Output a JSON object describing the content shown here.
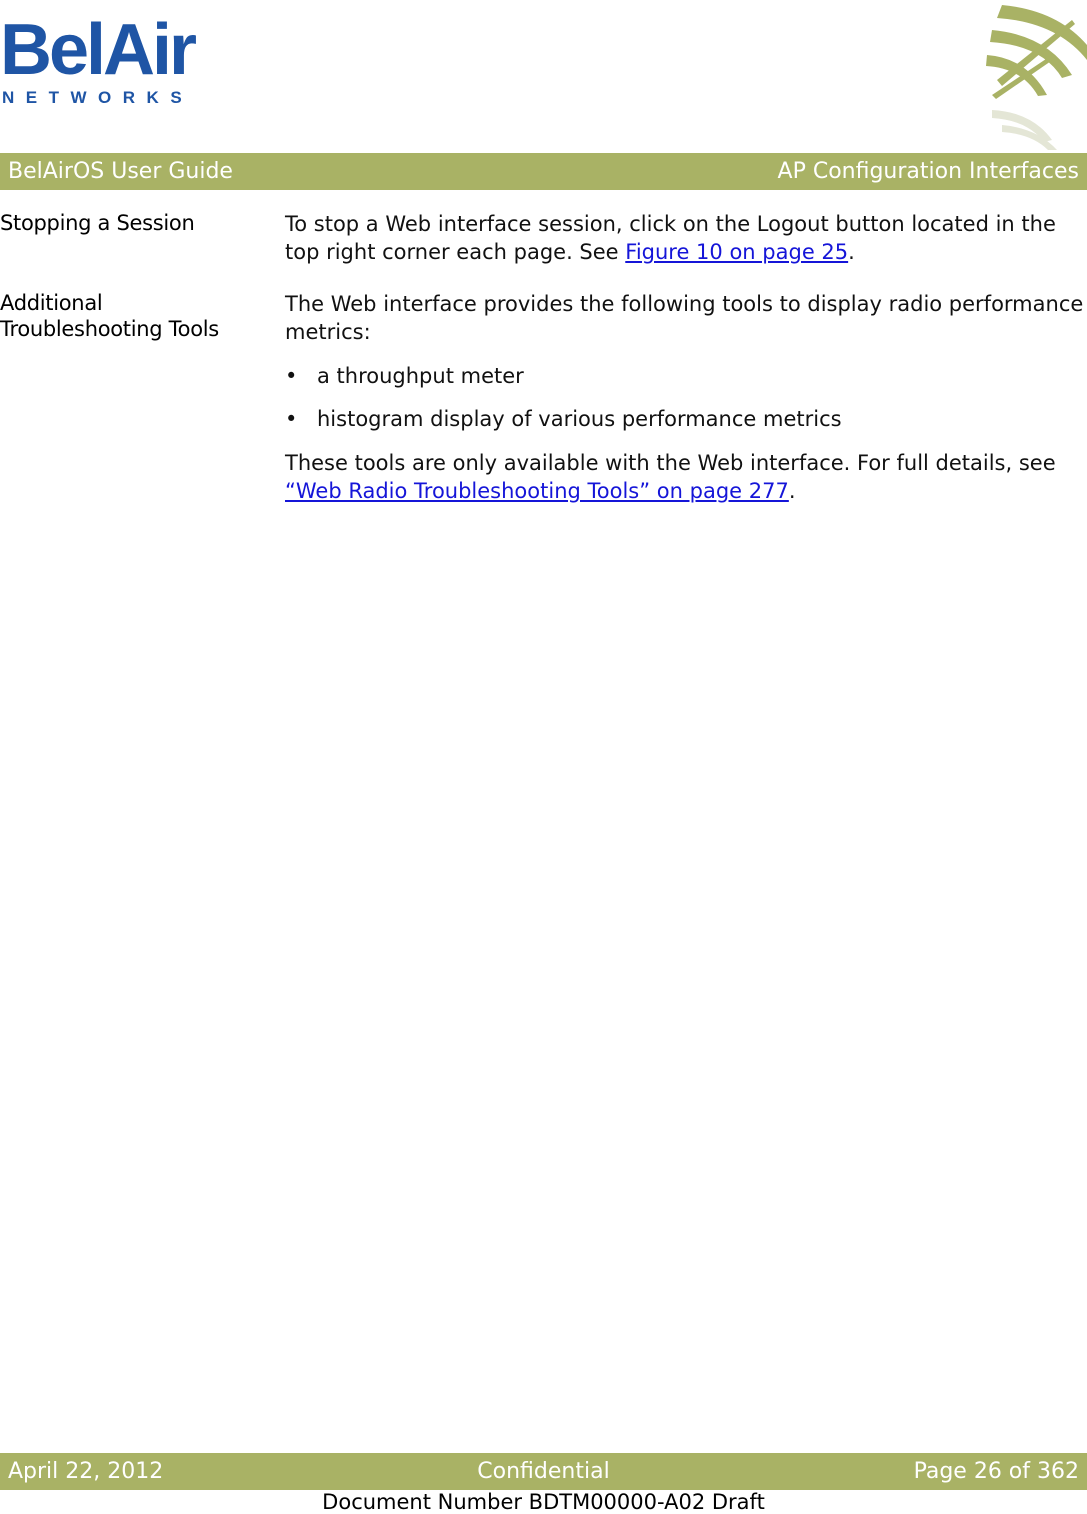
{
  "logo": {
    "name": "BelAir",
    "sub": "NETWORKS",
    "brand_color": "#1f55a5"
  },
  "header": {
    "left": "BelAirOS User Guide",
    "right": "AP Configuration Interfaces",
    "band_color": "#a9b265"
  },
  "sections": [
    {
      "heading": "Stopping a Session",
      "text_before": "To stop a Web interface session, click on the Logout button located in the top right corner each page. See ",
      "link": "Figure 10 on page 25",
      "text_after": "."
    },
    {
      "heading_line1": "Additional",
      "heading_line2": "Troubleshooting Tools",
      "intro": "The Web interface provides the following tools to display radio performance metrics:",
      "bullets": [
        "a throughput meter",
        "histogram display of various performance metrics"
      ],
      "bullet_glyph": "•",
      "closing_before": "These tools are only available with the Web interface. For full details, see ",
      "closing_link": "“Web Radio Troubleshooting Tools” on page 277",
      "closing_after": "."
    }
  ],
  "footer": {
    "date": "April 22, 2012",
    "center": "Confidential",
    "page": "Page 26 of 362",
    "document_number": "Document Number BDTM00000-A02 Draft"
  },
  "colors": {
    "link": "#1515d8"
  }
}
